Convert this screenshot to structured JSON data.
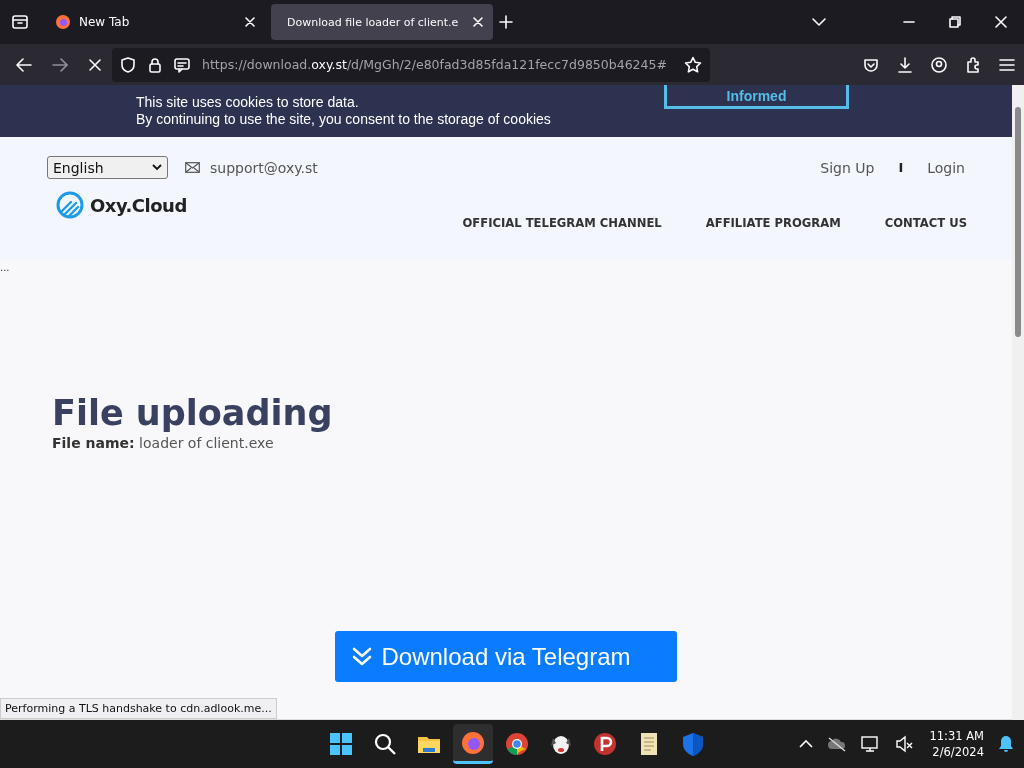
{
  "browser": {
    "tabs": [
      {
        "title": "New Tab",
        "selected": false
      },
      {
        "title": "Download file loader of client.e",
        "selected": true
      }
    ],
    "url": {
      "prefix": "https://download.",
      "domain": "oxy.st",
      "path": "/d/MgGh/2/e80fad3d85fda121fecc7d9850b46245#"
    },
    "status_text": "Performing a TLS handshake to cdn.adlook.me..."
  },
  "cookie_banner": {
    "lines": [
      "This site uses cookies to store data.",
      "By continuing to use the site, you consent to the storage of cookies"
    ],
    "button": "Informed"
  },
  "header": {
    "language": "English",
    "email": "support@oxy.st",
    "auth": [
      "Sign Up",
      "Login"
    ],
    "separator": "I",
    "logo": "Oxy.Cloud",
    "nav": [
      "OFFICIAL TELEGRAM CHANNEL",
      "AFFILIATE PROGRAM",
      "CONTACT US"
    ]
  },
  "side_mark": "...",
  "main": {
    "title": "File uploading",
    "file_label": "File name:",
    "file_name": "loader of client.exe",
    "download_button": "Download via Telegram"
  },
  "taskbar": {
    "time": "11:31 AM",
    "date": "2/6/2024"
  }
}
